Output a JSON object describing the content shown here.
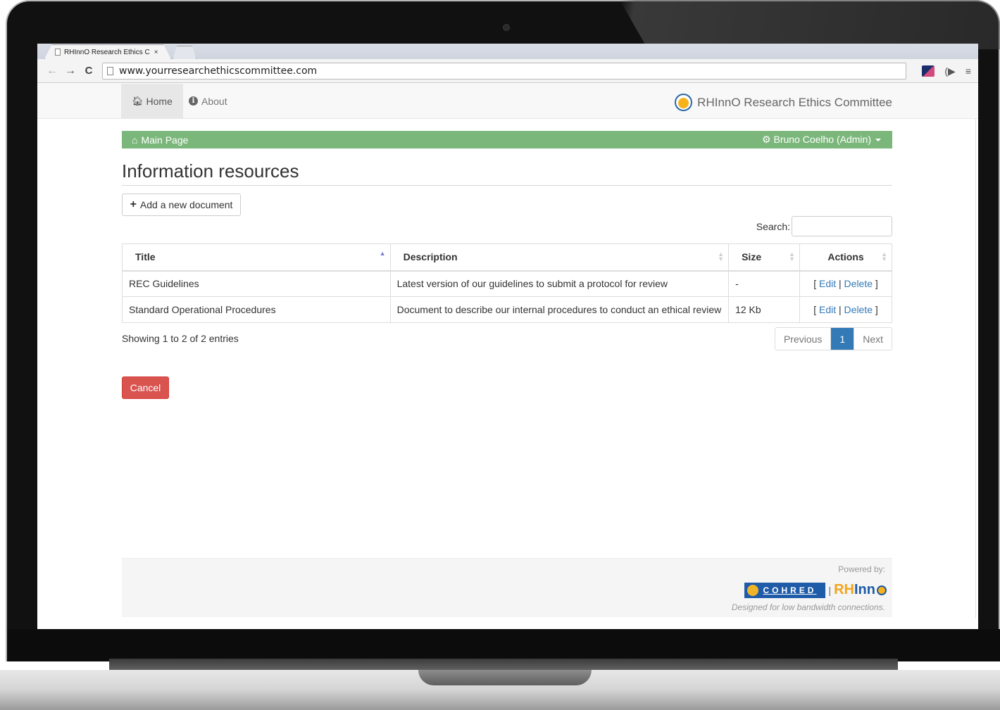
{
  "browser": {
    "tab_title": "RHInnO Research Ethics C",
    "tab_close": "×",
    "url": "www.yourresearchethicscommittee.com",
    "back_glyph": "←",
    "forward_glyph": "→",
    "refresh_glyph": "C",
    "menu_glyph": "≡",
    "speaker_glyph": "(▶"
  },
  "navbar": {
    "home_label": "Home",
    "about_label": "About",
    "brand": "RHInnO Research Ethics Committee"
  },
  "breadcrumb": {
    "label": "Main Page",
    "user": "Bruno Coelho (Admin)"
  },
  "page": {
    "title": "Information resources",
    "add_button": "Add a new document",
    "search_label": "Search:",
    "search_value": ""
  },
  "table": {
    "columns": [
      "Title",
      "Description",
      "Size",
      "Actions"
    ],
    "rows": [
      {
        "title": "REC Guidelines",
        "description": "Latest version of our guidelines to submit a protocol for review",
        "size": "-",
        "edit": "Edit",
        "delete": "Delete"
      },
      {
        "title": "Standard Operational Procedures",
        "description": "Document to describe our internal procedures to conduct an ethical review",
        "size": "12 Kb",
        "edit": "Edit",
        "delete": "Delete"
      }
    ],
    "info": "Showing 1 to 2 of 2 entries",
    "pager": {
      "previous": "Previous",
      "current": "1",
      "next": "Next"
    }
  },
  "cancel_button": "Cancel",
  "footer": {
    "powered_by": "Powered by:",
    "cohred": "COHRED",
    "separator": "|",
    "rhinno_rh": "RH",
    "rhinno_inn": "Inn",
    "tagline": "Designed for low bandwidth connections."
  },
  "colors": {
    "breadcrumb_bg": "#7bb77b",
    "primary": "#337ab7",
    "danger": "#d9534f"
  }
}
